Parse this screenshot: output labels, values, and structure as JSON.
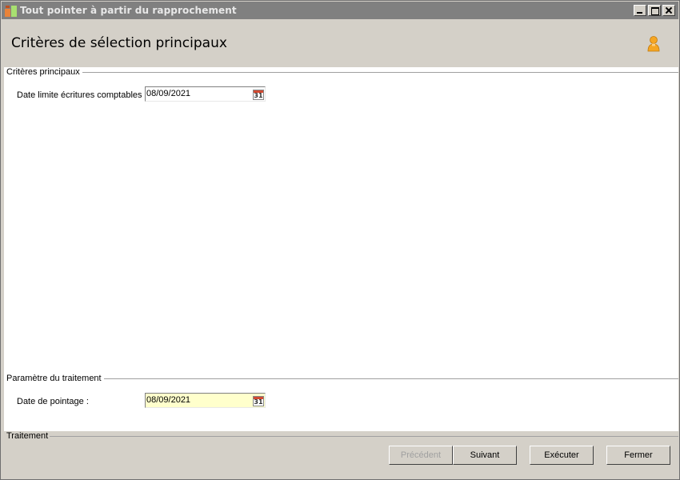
{
  "window": {
    "title": "Tout pointer à partir du rapprochement"
  },
  "header": {
    "title": "Critères de sélection principaux",
    "user_icon": "user-icon"
  },
  "groups": {
    "main_criteria": {
      "label": "Critères principaux",
      "date_limit_label": "Date limite écritures comptables :",
      "date_limit_value": "08/09/2021"
    },
    "processing_params": {
      "label": "Paramètre du traitement",
      "pointing_date_label": "Date de pointage :",
      "pointing_date_value": "08/09/2021"
    }
  },
  "calendar_icon_text": "31",
  "footer": {
    "label": "Traitement",
    "buttons": {
      "previous": "Précédent",
      "next": "Suivant",
      "execute": "Exécuter",
      "close": "Fermer"
    }
  },
  "colors": {
    "titlebar": "#808080",
    "field_highlight": "#ffffcc",
    "user_icon": "#f5a623"
  }
}
